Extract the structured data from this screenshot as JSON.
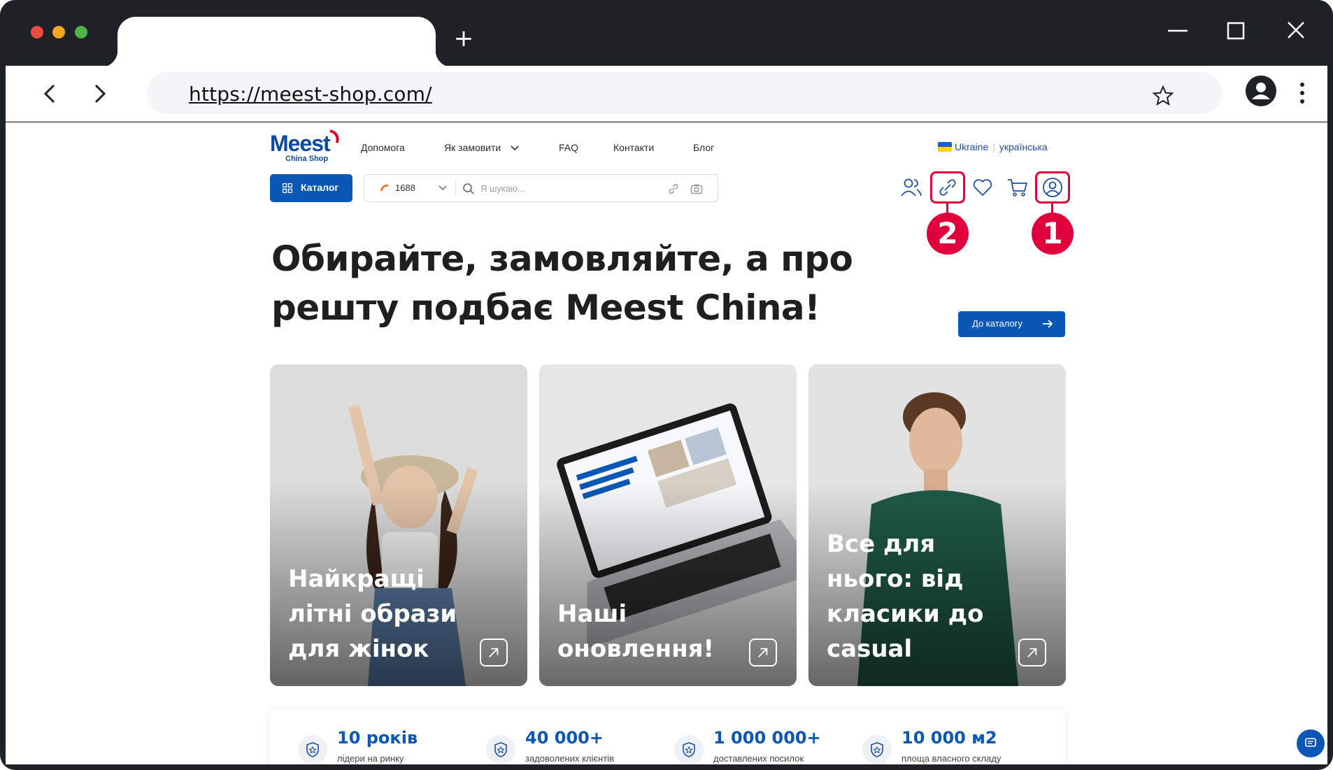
{
  "browser": {
    "url": "https://meest-shop.com/"
  },
  "site": {
    "logo": {
      "name": "Meest",
      "sub": "China Shop"
    },
    "nav": [
      {
        "label": "Допомога"
      },
      {
        "label": "Як замовити"
      },
      {
        "label": "FAQ"
      },
      {
        "label": "Контакти"
      },
      {
        "label": "Блог"
      }
    ],
    "lang": {
      "country": "Ukraine",
      "language": "українська"
    },
    "catalog_label": "Каталог",
    "search": {
      "source": "1688",
      "placeholder": "Я шукаю..."
    },
    "annotations": {
      "first": "1",
      "second": "2"
    },
    "hero": {
      "title": "Обирайте, замовляйте, а про решту подбає Meest China!",
      "cta": "До каталогу"
    },
    "cards": [
      {
        "title": "Найкращі літні образи для жінок"
      },
      {
        "title": "Наші оновлення!"
      },
      {
        "title": "Все для нього: від класики до casual"
      }
    ],
    "stats": [
      {
        "value": "10 років",
        "label": "лідери на ринку"
      },
      {
        "value": "40 000+",
        "label": "задоволених клієнтів"
      },
      {
        "value": "1 000 000+",
        "label": "доставлених посилок"
      },
      {
        "value": "10 000 м2",
        "label": "площа власного складу"
      }
    ]
  },
  "colors": {
    "brand_blue": "#0b57b5",
    "highlight_red": "#e0003c"
  }
}
